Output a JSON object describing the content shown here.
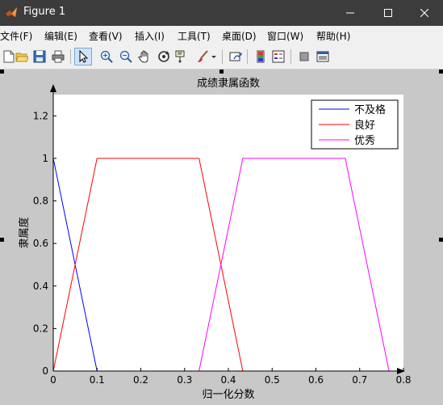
{
  "window": {
    "title": "Figure 1",
    "controls": [
      "minimize",
      "maximize",
      "close"
    ]
  },
  "menubar": {
    "items": [
      {
        "label": "文件(F)"
      },
      {
        "label": "编辑(E)"
      },
      {
        "label": "查看(V)"
      },
      {
        "label": "插入(I)"
      },
      {
        "label": "工具(T)"
      },
      {
        "label": "桌面(D)"
      },
      {
        "label": "窗口(W)"
      },
      {
        "label": "帮助(H)"
      }
    ]
  },
  "toolbar": {
    "icons": [
      "new-file-icon",
      "open-folder-icon",
      "save-icon",
      "print-icon",
      "select-arrow-icon",
      "zoom-in-icon",
      "zoom-out-icon",
      "pan-hand-icon",
      "rotate-3d-icon",
      "data-cursor-icon",
      "brush-icon",
      "link-plot-icon",
      "colorbar-icon",
      "legend-icon",
      "hide-plot-tools-icon",
      "show-plot-tools-icon"
    ]
  },
  "chart_data": {
    "type": "line",
    "title": "成绩隶属函数",
    "xlabel": "归一化分数",
    "ylabel": "隶属度",
    "xlim": [
      0,
      0.8
    ],
    "ylim": [
      0,
      1.3
    ],
    "xticks": [
      "0",
      "0.1",
      "0.2",
      "0.3",
      "0.4",
      "0.5",
      "0.6",
      "0.7",
      "0.8"
    ],
    "yticks": [
      "0",
      "0.2",
      "0.4",
      "0.6",
      "0.8",
      "1",
      "1.2"
    ],
    "legend_position": "top-right",
    "series": [
      {
        "name": "不及格",
        "color": "#0000ff",
        "x": [
          0,
          0.1
        ],
        "y": [
          1,
          0
        ]
      },
      {
        "name": "良好",
        "color": "#ff0000",
        "x": [
          0,
          0.1,
          0.333,
          0.433
        ],
        "y": [
          0,
          1,
          1,
          0
        ]
      },
      {
        "name": "优秀",
        "color": "#ff00ff",
        "x": [
          0.333,
          0.433,
          0.667,
          0.767
        ],
        "y": [
          0,
          1,
          1,
          0
        ]
      }
    ]
  }
}
